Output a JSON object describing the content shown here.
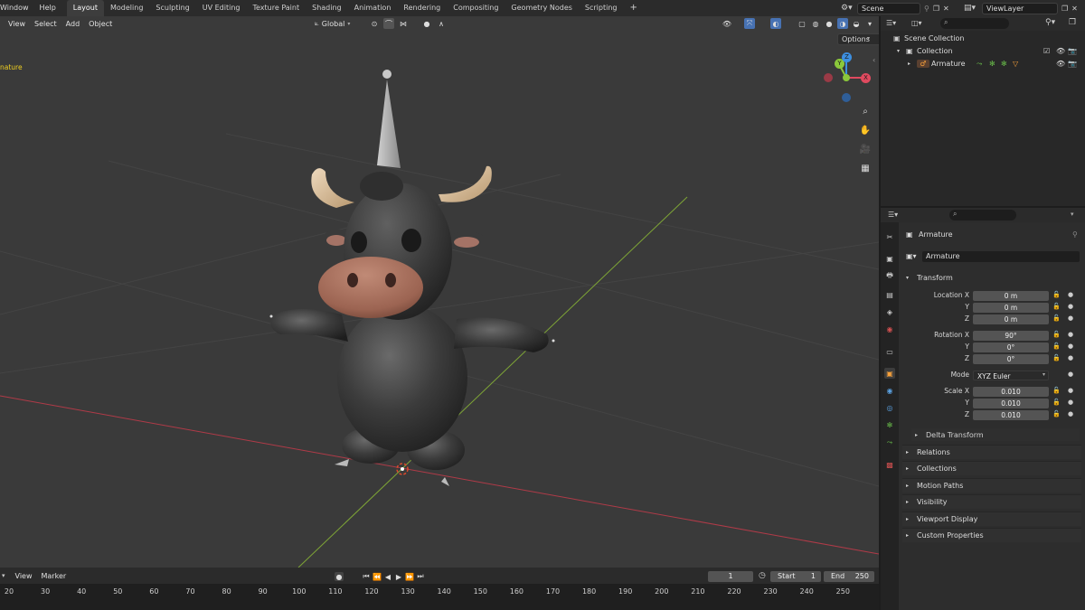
{
  "topbar": {
    "menus": [
      "Window",
      "Help"
    ],
    "workspaces": [
      "Layout",
      "Modeling",
      "Sculpting",
      "UV Editing",
      "Texture Paint",
      "Shading",
      "Animation",
      "Rendering",
      "Compositing",
      "Geometry Nodes",
      "Scripting"
    ],
    "active_workspace": "Layout",
    "add_tab": "+",
    "scene": "Scene",
    "view_layer": "ViewLayer"
  },
  "viewport": {
    "menus": [
      "View",
      "Select",
      "Add",
      "Object"
    ],
    "orientation": "Global",
    "options_label": "Options",
    "object_label": "nature",
    "gizmo": {
      "x": "X",
      "y": "Y",
      "z": "Z"
    }
  },
  "outliner": {
    "rows": [
      {
        "label": "Scene Collection"
      },
      {
        "label": "Collection"
      },
      {
        "label": "Armature"
      }
    ]
  },
  "properties": {
    "object_name": "Armature",
    "data_name": "Armature",
    "transform_title": "Transform",
    "location": {
      "label": "Location X",
      "x": "0 m",
      "y": "0 m",
      "z": "0 m"
    },
    "rotation": {
      "label": "Rotation X",
      "x": "90°",
      "y": "0°",
      "z": "0°"
    },
    "mode": {
      "label": "Mode",
      "value": "XYZ Euler"
    },
    "scale": {
      "label": "Scale X",
      "x": "0.010",
      "y": "0.010",
      "z": "0.010"
    },
    "axis_y": "Y",
    "axis_z": "Z",
    "sections": [
      "Delta Transform",
      "Relations",
      "Collections",
      "Motion Paths",
      "Visibility",
      "Viewport Display",
      "Custom Properties"
    ]
  },
  "timeline": {
    "menus": [
      "View",
      "Marker"
    ],
    "current_frame": "1",
    "start_label": "Start",
    "start": "1",
    "end_label": "End",
    "end": "250",
    "ticks": [
      "20",
      "30",
      "40",
      "50",
      "60",
      "70",
      "80",
      "90",
      "100",
      "110",
      "120",
      "130",
      "140",
      "150",
      "160",
      "170",
      "180",
      "190",
      "200",
      "210",
      "220",
      "230",
      "240",
      "250"
    ]
  },
  "colors": {
    "accent": "#4772b3",
    "x_axis": "#e04a5f",
    "y_axis": "#8bc83b",
    "z_axis": "#3d8fe0",
    "active_object": "#f7a13b"
  }
}
